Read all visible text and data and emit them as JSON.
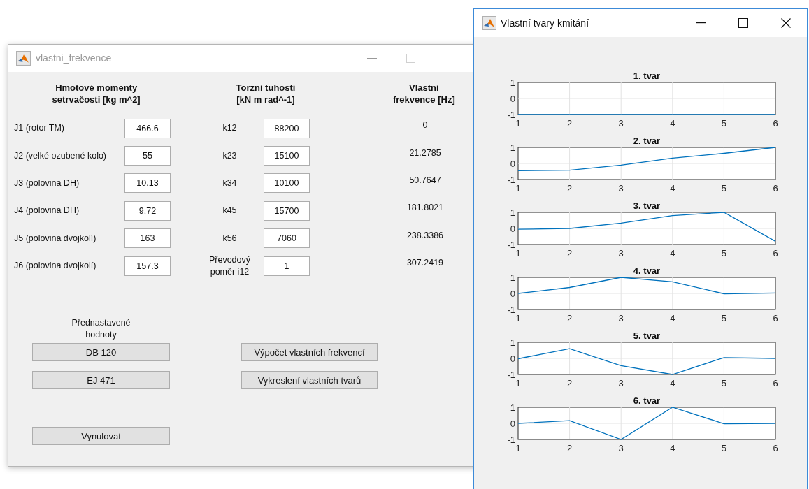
{
  "left_window": {
    "title": "vlastni_frekvence",
    "active": false,
    "headers": [
      "Hmotové momenty\nsetrvačosti [kg m^2]",
      "Torzní tuhosti\n[kN m rad^-1]",
      "Vlastní\nfrekvence [Hz]"
    ],
    "rows": [
      {
        "inertia_label": "J1 (rotor TM)",
        "inertia_value": "466.6",
        "stiffness_label": "k12",
        "stiffness_value": "88200",
        "frequency": "0"
      },
      {
        "inertia_label": "J2 (velké ozubené kolo)",
        "inertia_value": "55",
        "stiffness_label": "k23",
        "stiffness_value": "15100",
        "frequency": "21.2785"
      },
      {
        "inertia_label": "J3 (polovina DH)",
        "inertia_value": "10.13",
        "stiffness_label": "k34",
        "stiffness_value": "10100",
        "frequency": "50.7647"
      },
      {
        "inertia_label": "J4 (polovina DH)",
        "inertia_value": "9.72",
        "stiffness_label": "k45",
        "stiffness_value": "15700",
        "frequency": "181.8021"
      },
      {
        "inertia_label": "J5 (polovina dvojkolí)",
        "inertia_value": "163",
        "stiffness_label": "k56",
        "stiffness_value": "7060",
        "frequency": "238.3386"
      },
      {
        "inertia_label": "J6 (polovina dvojkolí)",
        "inertia_value": "157.3",
        "stiffness_label": "Převodový\npoměr i12",
        "stiffness_value": "1",
        "frequency": "307.2419"
      }
    ],
    "presets_label": "Přednastavené\nhodnoty",
    "preset_buttons": [
      "DB 120",
      "EJ 471"
    ],
    "reset_button": "Vynulovat",
    "action_buttons": [
      "Výpočet vlastních frekvencí",
      "Vykreslení vlastních tvarů"
    ]
  },
  "right_window": {
    "title": "Vlastní tvary kmitání",
    "active": true,
    "plots": [
      {
        "chart_data": {
          "type": "line",
          "title": "1. tvar",
          "grid": true,
          "x": [
            1,
            2,
            3,
            4,
            5,
            6
          ],
          "series": [
            {
              "color": "#0072bd",
              "values": [
                -1,
                -1,
                -1,
                -1,
                -1,
                -1
              ]
            }
          ],
          "xlim": [
            1,
            6
          ],
          "ylim": [
            -1,
            1
          ],
          "xticks": [
            1,
            2,
            3,
            4,
            5,
            6
          ],
          "yticks": [
            -1,
            0,
            1
          ]
        }
      },
      {
        "chart_data": {
          "type": "line",
          "title": "2. tvar",
          "grid": true,
          "x": [
            1,
            2,
            3,
            4,
            5,
            6
          ],
          "series": [
            {
              "color": "#0072bd",
              "values": [
                -0.45,
                -0.42,
                -0.1,
                0.33,
                0.63,
                1
              ]
            }
          ],
          "xlim": [
            1,
            6
          ],
          "ylim": [
            -1,
            1
          ],
          "xticks": [
            1,
            2,
            3,
            4,
            5,
            6
          ],
          "yticks": [
            -1,
            0,
            1
          ]
        }
      },
      {
        "chart_data": {
          "type": "line",
          "title": "3. tvar",
          "grid": true,
          "x": [
            1,
            2,
            3,
            4,
            5,
            6
          ],
          "series": [
            {
              "color": "#0072bd",
              "values": [
                -0.05,
                0,
                0.33,
                0.8,
                1,
                -0.8
              ]
            }
          ],
          "xlim": [
            1,
            6
          ],
          "ylim": [
            -1,
            1
          ],
          "xticks": [
            1,
            2,
            3,
            4,
            5,
            6
          ],
          "yticks": [
            -1,
            0,
            1
          ]
        }
      },
      {
        "chart_data": {
          "type": "line",
          "title": "4. tvar",
          "grid": true,
          "x": [
            1,
            2,
            3,
            4,
            5,
            6
          ],
          "series": [
            {
              "color": "#0072bd",
              "values": [
                0,
                0.37,
                1,
                0.72,
                -0.02,
                0.03
              ]
            }
          ],
          "xlim": [
            1,
            6
          ],
          "ylim": [
            -1,
            1
          ],
          "xticks": [
            1,
            2,
            3,
            4,
            5,
            6
          ],
          "yticks": [
            -1,
            0,
            1
          ]
        }
      },
      {
        "chart_data": {
          "type": "line",
          "title": "5. tvar",
          "grid": true,
          "x": [
            1,
            2,
            3,
            4,
            5,
            6
          ],
          "series": [
            {
              "color": "#0072bd",
              "values": [
                -0.02,
                0.6,
                -0.45,
                -1,
                0.05,
                0
              ]
            }
          ],
          "xlim": [
            1,
            6
          ],
          "ylim": [
            -1,
            1
          ],
          "xticks": [
            1,
            2,
            3,
            4,
            5,
            6
          ],
          "yticks": [
            -1,
            0,
            1
          ]
        }
      },
      {
        "chart_data": {
          "type": "line",
          "title": "6. tvar",
          "grid": true,
          "x": [
            1,
            2,
            3,
            4,
            5,
            6
          ],
          "series": [
            {
              "color": "#0072bd",
              "values": [
                0,
                0.17,
                -1,
                1,
                -0.02,
                0
              ]
            }
          ],
          "xlim": [
            1,
            6
          ],
          "ylim": [
            -1,
            1
          ],
          "xticks": [
            1,
            2,
            3,
            4,
            5,
            6
          ],
          "yticks": [
            -1,
            0,
            1
          ]
        }
      }
    ]
  }
}
